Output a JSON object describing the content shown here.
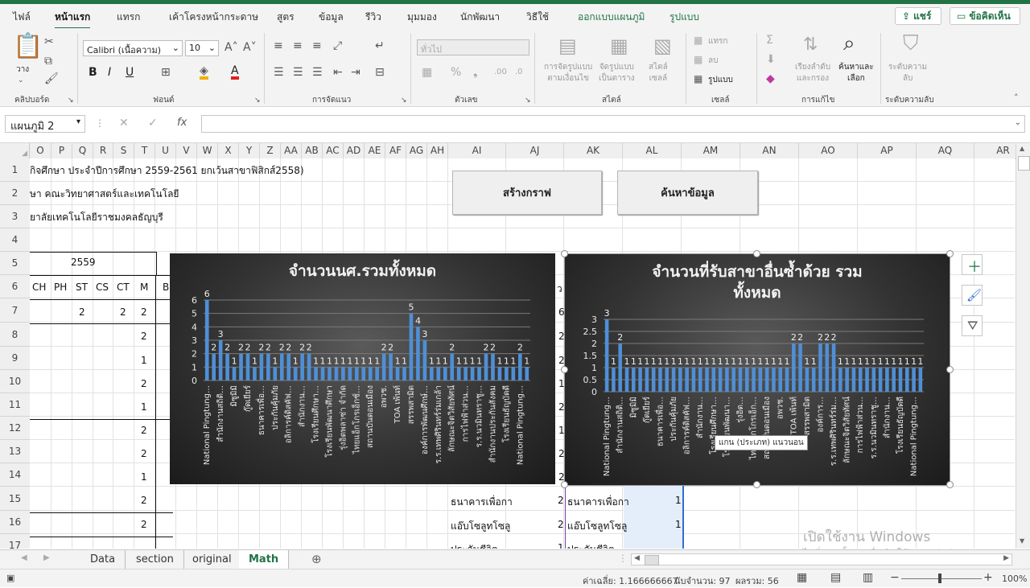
{
  "ribbon_tabs": [
    "ไฟล์",
    "หน้าแรก",
    "แทรก",
    "เค้าโครงหน้ากระดาษ",
    "สูตร",
    "ข้อมูล",
    "รีวิว",
    "มุมมอง",
    "นักพัฒนา",
    "วิธีใช้",
    "ออกแบบแผนภูมิ",
    "รูปแบบ"
  ],
  "share_label": "แชร์",
  "comments_label": "ข้อคิดเห็น",
  "ribbon": {
    "clipboard": {
      "paste": "วาง",
      "group": "คลิปบอร์ด"
    },
    "font": {
      "name": "Calibri (เนื้อความ)",
      "size": "10",
      "group": "ฟอนต์"
    },
    "alignment": {
      "group": "การจัดแนว"
    },
    "number": {
      "format": "ทั่วไป",
      "group": "ตัวเลข"
    },
    "styles": {
      "cond_format": "การจัดรูปแบบ\nตามเงื่อนไข",
      "format_table": "จัดรูปแบบ\nเป็นตาราง",
      "cell_styles": "สไตล์\nเซลล์",
      "group": "สไตล์"
    },
    "cells": {
      "insert": "แทรก",
      "delete": "ลบ",
      "format": "รูปแบบ",
      "group": "เซลล์"
    },
    "editing": {
      "sort_filter": "เรียงลำดับ\nและกรอง",
      "find_select": "ค้นหาและ\nเลือก",
      "group": "การแก้ไข"
    },
    "sensitivity": {
      "label": "ระดับความ\nลับ",
      "group": "ระดับความลับ"
    }
  },
  "name_box": "แผนภูมิ 2",
  "columns": [
    "O",
    "P",
    "Q",
    "R",
    "S",
    "T",
    "U",
    "V",
    "W",
    "X",
    "Y",
    "Z",
    "AA",
    "AB",
    "AC",
    "AD",
    "AE",
    "AF",
    "AG",
    "AH",
    "AI",
    "AJ",
    "AK",
    "AL",
    "AM",
    "AN",
    "AO",
    "AP",
    "AQ",
    "AR"
  ],
  "rows": [
    "1",
    "2",
    "3",
    "4",
    "5",
    "6",
    "7",
    "8",
    "9",
    "10",
    "11",
    "12",
    "13",
    "14",
    "15",
    "16",
    "17"
  ],
  "cells": {
    "r1": "กิจศึกษา ประจำปีการศึกษา 2559-2561 ยกเว้นสาขาฟิสิกส์2558)",
    "r2": "ษา คณะวิทยาศาสตร์และเทคโนโลยี",
    "r3": "ยาลัยเทคโนโลยีราชมงคลธัญบุรี",
    "year": "2559",
    "hdr": [
      "CH",
      "PH",
      "ST",
      "CS",
      "CT",
      "M",
      "B"
    ],
    "r7": [
      "2",
      "2",
      "2"
    ],
    "m_col": [
      "2",
      "1",
      "2",
      "1",
      "2",
      "2",
      "1",
      "2",
      "2"
    ],
    "r15_ai": "ธนาคารเพื่อกา",
    "r15_aj": "2",
    "r15_ak": "ธนาคารเพื่อกา",
    "r15_al": "1",
    "r16_ai": "แอ๊บโซลูทโซลู",
    "r16_aj": "2",
    "r16_ak": "แอ๊บโซลูทโซลู",
    "r16_al": "1",
    "r17_ai": "ประกันชีวิต",
    "r17_aj": "1",
    "r17_ak": "ประกันชีวิต",
    "peek_letter": "ว",
    "peek_vals": [
      "6",
      "2",
      "2",
      "1",
      "2",
      "1",
      "2",
      "2",
      "1",
      "2"
    ]
  },
  "buttons": {
    "create_chart": "สร้างกราฟ",
    "search_data": "ค้นหาข้อมูล"
  },
  "tooltip": "แกน (ประเภท) แนวนอน",
  "sheets": [
    "Data",
    "section",
    "original",
    "Math"
  ],
  "active_sheet": "Math",
  "status": {
    "average": "ค่าเฉลี่ย: 1.166666667",
    "count": "นับจำนวน: 97",
    "sum": "ผลรวม: 56",
    "zoom": "100%"
  },
  "watermark": {
    "line1": "เปิดใช้งาน Windows",
    "line2": "ไปที่ การตั้งค่า เพื่อเปิดใช้งาน Windows"
  },
  "chart_data": [
    {
      "type": "bar",
      "title": "จำนวนนศ.รวมทั้งหมด",
      "ylim": [
        0,
        6
      ],
      "yticks": [
        0,
        1,
        2,
        3,
        4,
        5,
        6
      ],
      "grid": true,
      "bar_color": "#4f8fd6",
      "values": [
        6,
        2,
        3,
        2,
        1,
        2,
        2,
        1,
        2,
        2,
        1,
        2,
        2,
        1,
        2,
        2,
        1,
        1,
        1,
        1,
        1,
        1,
        1,
        1,
        1,
        1,
        2,
        2,
        1,
        1,
        5,
        4,
        3,
        1,
        1,
        1,
        2,
        1,
        1,
        1,
        1,
        2,
        2,
        1,
        1,
        1,
        2,
        1
      ],
      "categories": [
        "National Pingtung…",
        "",
        "สำนักงานสถิติ…",
        "",
        "มิซูมิมิ",
        "",
        "กู๊ดเยียร์",
        "",
        "ธนาคารเพื่อ…",
        "",
        "ประกันคุ้มภัย",
        "",
        "อลิการค์ดิสคัฟ…",
        "",
        "สำนักงาน…",
        "",
        "โรงเรียนศึกษา…",
        "",
        "โรงเรียนพัฒนาศึกษา",
        "",
        "รุ่งอิตพลาซ่า จำกัด",
        "",
        "ไทยแอ็กโกรเอ็กซ์…",
        "",
        "สถานบันดอนเมือง",
        "",
        "อพวช.",
        "",
        "TOA เพ้นท์",
        "",
        "สรรพสามิต",
        "",
        "องค์การพัฒนศึกษ์…",
        "",
        "ร.ร.เทพศิรินทร์ร่มเกล้า",
        "",
        "ลักษณะจิตวิสัยทัศน์",
        "",
        "การไฟฟ้าส่วน…",
        "",
        "ร.ร.นวมินทราชู…",
        "",
        "สำนักงานประกันสังคม",
        "",
        "โรงเรียนธัญบัดดี",
        "",
        "National Pingtung…",
        ""
      ]
    },
    {
      "type": "bar",
      "title": "จำนวนที่รับสาขาอื่นซ้ำด้วย รวมทั้งหมด",
      "ylim": [
        0,
        3
      ],
      "yticks": [
        "0",
        "0.5",
        "1",
        "1.5",
        "2",
        "2.5",
        "3"
      ],
      "grid": true,
      "bar_color": "#4f8fd6",
      "values": [
        3,
        1,
        2,
        1,
        1,
        1,
        1,
        1,
        1,
        1,
        1,
        1,
        1,
        1,
        1,
        1,
        1,
        1,
        1,
        1,
        1,
        1,
        1,
        1,
        1,
        1,
        1,
        1,
        2,
        2,
        1,
        1,
        2,
        2,
        2,
        1,
        1,
        1,
        1,
        1,
        1,
        1,
        1,
        1,
        1,
        1,
        1,
        1
      ],
      "categories": [
        "National Pingtung…",
        "",
        "สำนักงานสถิติ…",
        "",
        "มิซูมิมิ",
        "",
        "กู๊ดเยียร์",
        "",
        "ธนาคารเพื่อ…",
        "",
        "ประกันคุ้มภัย",
        "",
        "อลิการค์ดิสคัฟ…",
        "",
        "สำนักงาน…",
        "",
        "โรงเรียนศึกษา…",
        "",
        "โรงเรียนพัฒนา…",
        "",
        "รุ่งอิต…",
        "",
        "ไทยแอ็กโกรเอ็ก…",
        "",
        "สถานบันดอนเมือง",
        "",
        "อพวช.",
        "",
        "TOA เพ้นท์",
        "",
        "สรรพสามิต",
        "",
        "องค์การ…",
        "",
        "ร.ร.เทพศิรินทร์ร่ม…",
        "",
        "ลักษณะจิตวิสัยทัศน์",
        "",
        "การไฟฟ้าส่วน…",
        "",
        "ร.ร.นวมินทราชู…",
        "",
        "สำนักงาน…",
        "",
        "โรงเรียนธัญบัดดี",
        "",
        "National Pingtung…",
        ""
      ]
    }
  ]
}
